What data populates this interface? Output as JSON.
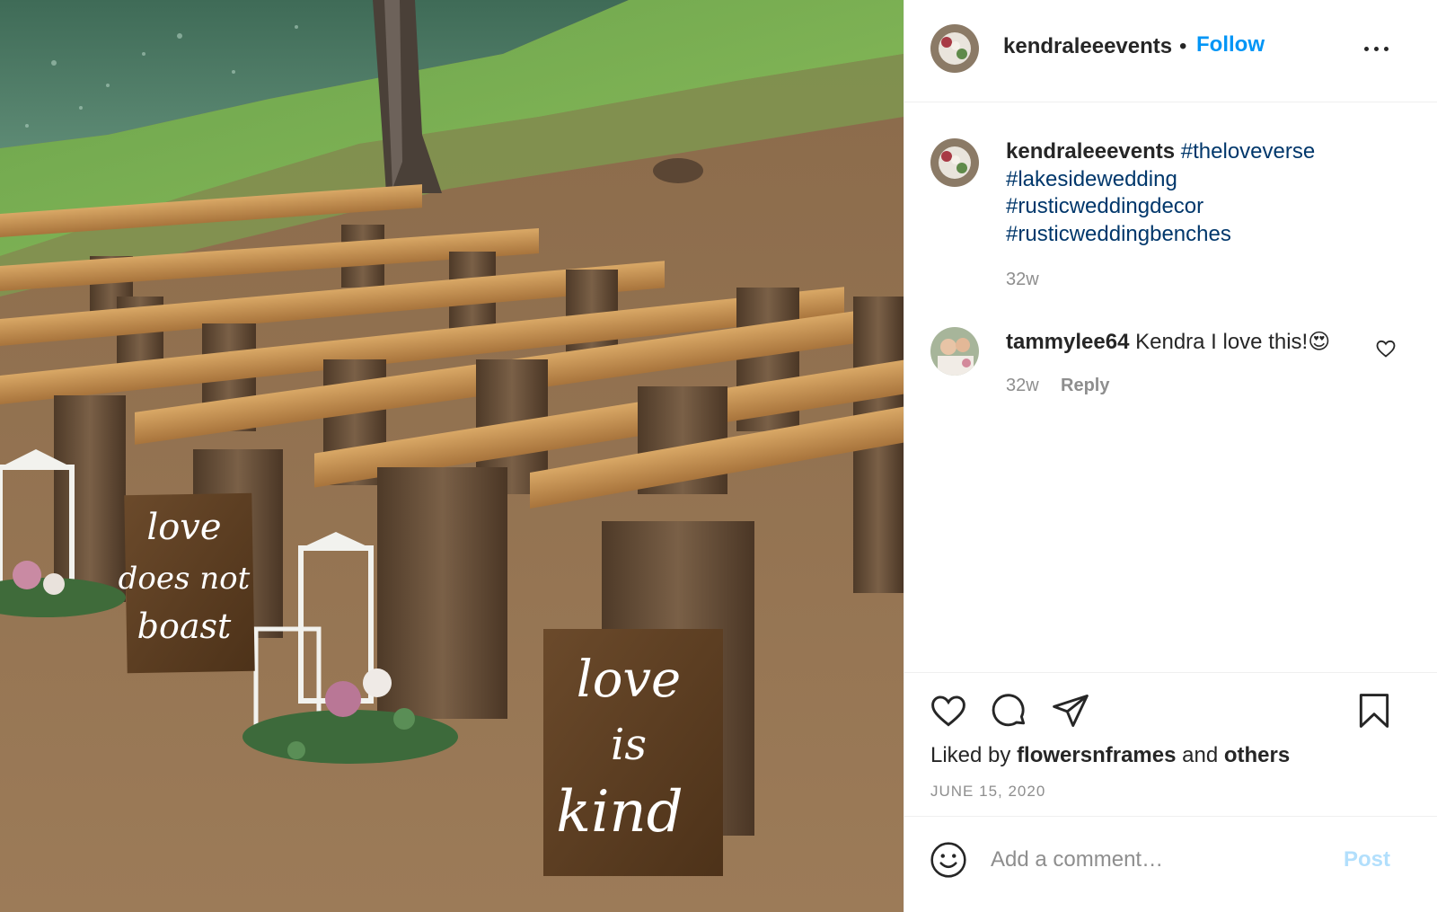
{
  "post": {
    "photo_signs": {
      "left_sign": [
        "love",
        "does not",
        "boast"
      ],
      "right_sign": [
        "love",
        "is",
        "kind"
      ]
    }
  },
  "header": {
    "username": "kendraleeevents",
    "separator": "•",
    "follow_label": "Follow",
    "more_icon": "more-horizontal-icon"
  },
  "caption": {
    "username": "kendraleeevents",
    "hashtags": [
      "#theloveverse",
      "#lakesidewedding",
      "#rusticweddingdecor",
      "#rusticweddingbenches"
    ],
    "time": "32w"
  },
  "comments": [
    {
      "username": "tammylee64",
      "text": "Kendra I love this!",
      "emoji": "😍",
      "time": "32w",
      "reply_label": "Reply",
      "like_icon": "heart-outline-icon"
    }
  ],
  "actions": {
    "icons": [
      "heart-icon",
      "comment-icon",
      "share-icon",
      "bookmark-icon"
    ],
    "liked_by_prefix": "Liked by",
    "liked_by_user": "flowersnframes",
    "liked_by_and": "and",
    "liked_by_others": "others",
    "date": "June 15, 2020"
  },
  "add_comment": {
    "emoji_icon": "smiley-icon",
    "placeholder": "Add a comment…",
    "post_label": "Post"
  },
  "colors": {
    "accent": "#0095f6",
    "hashtag": "#00376b",
    "muted": "#8e8e8e",
    "post_disabled": "#b2dffc"
  }
}
